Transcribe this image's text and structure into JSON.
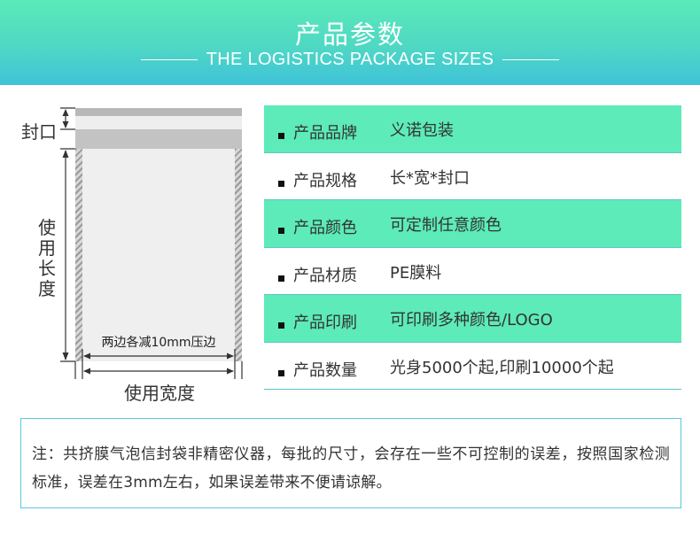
{
  "header": {
    "title": "产品参数",
    "subtitle": "THE LOGISTICS PACKAGE SIZES"
  },
  "diagram": {
    "seal_label": "封口",
    "length_label": "使用长度",
    "width_label": "使用宽度",
    "edge_note": "两边各减10mm压边"
  },
  "specs": [
    {
      "key": "产品品牌",
      "value": "义诺包装"
    },
    {
      "key": "产品规格",
      "value": "长*宽*封口"
    },
    {
      "key": "产品颜色",
      "value": "可定制任意颜色"
    },
    {
      "key": "产品材质",
      "value": "PE膜料"
    },
    {
      "key": "产品印刷",
      "value": "可印刷多种颜色/LOGO"
    },
    {
      "key": "产品数量",
      "value": "光身5000个起,印刷10000个起"
    }
  ],
  "note": {
    "text": "注：共挤膜气泡信封袋非精密仪器，每批的尺寸，会存在一些不可控制的误差，按照国家检测标准，误差在3mm左右，如果误差带来不便请谅解。"
  },
  "colors": {
    "accent": "#5cebb9",
    "header_bottom": "#3fc3d9",
    "border": "#58c9dc"
  }
}
